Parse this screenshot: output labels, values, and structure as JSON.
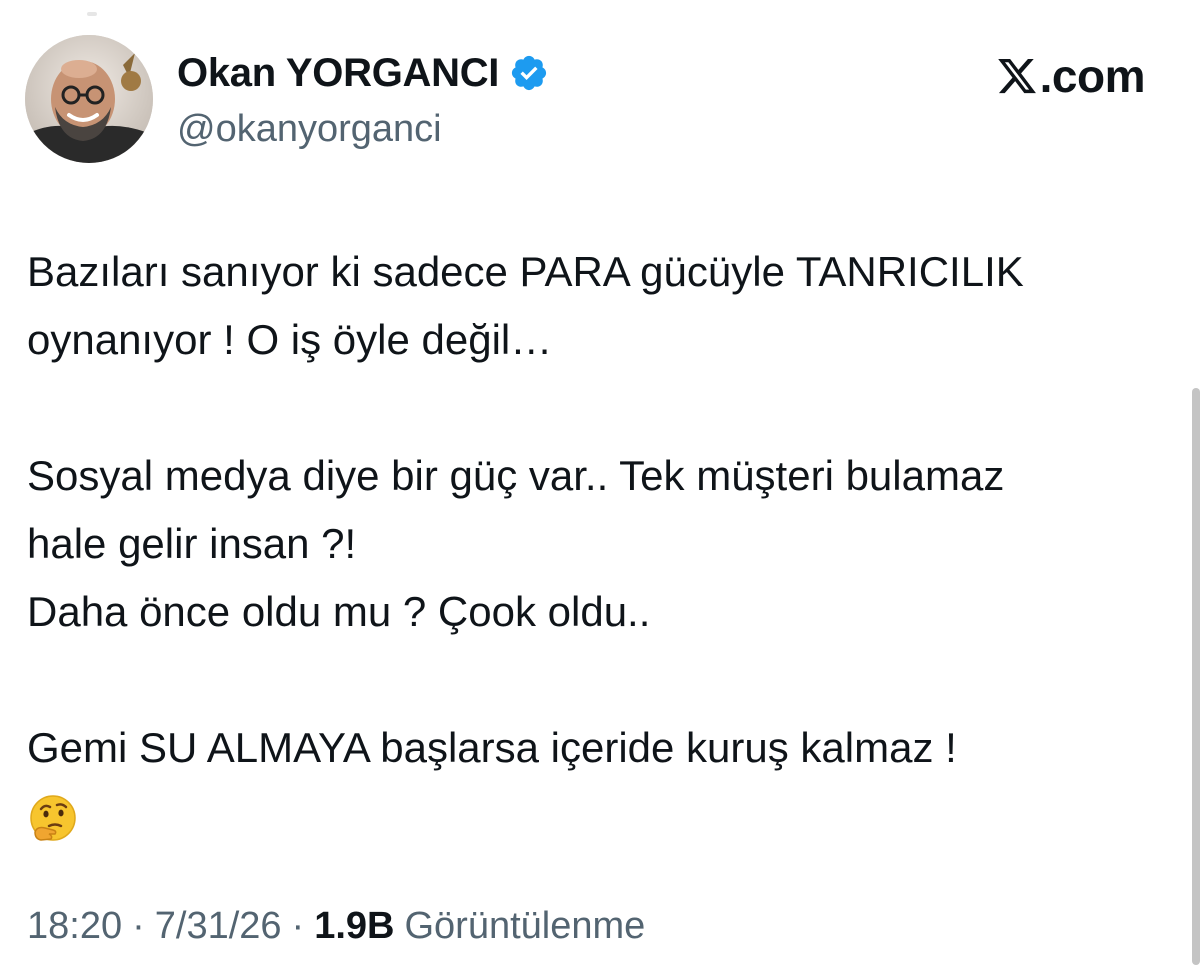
{
  "author": {
    "display_name": "Okan YORGANCI",
    "handle": "@okanyorganci",
    "verified": true,
    "avatar_icon": "avatar-photo",
    "verified_icon": "verified-badge-icon",
    "verified_color": "#1d9bf0"
  },
  "brand": {
    "icon": "x-logo-icon",
    "text": ".com"
  },
  "tweet": {
    "lines": [
      "Bazıları sanıyor ki sadece PARA gücüyle TANRICILIK",
      "oynanıyor ! O iş öyle değil…",
      "",
      "Sosyal medya diye bir güç var.. Tek müşteri bulamaz",
      "hale gelir insan ?!",
      "Daha önce oldu mu ? Çook oldu..",
      "",
      "Gemi SU ALMAYA başlarsa içeride kuruş kalmaz !"
    ],
    "emoji": "thinking-face-emoji"
  },
  "meta": {
    "time": "18:20",
    "date": "7/31/26",
    "separator": "·",
    "views_count": "1.9B",
    "views_label": "Görüntülenme"
  }
}
